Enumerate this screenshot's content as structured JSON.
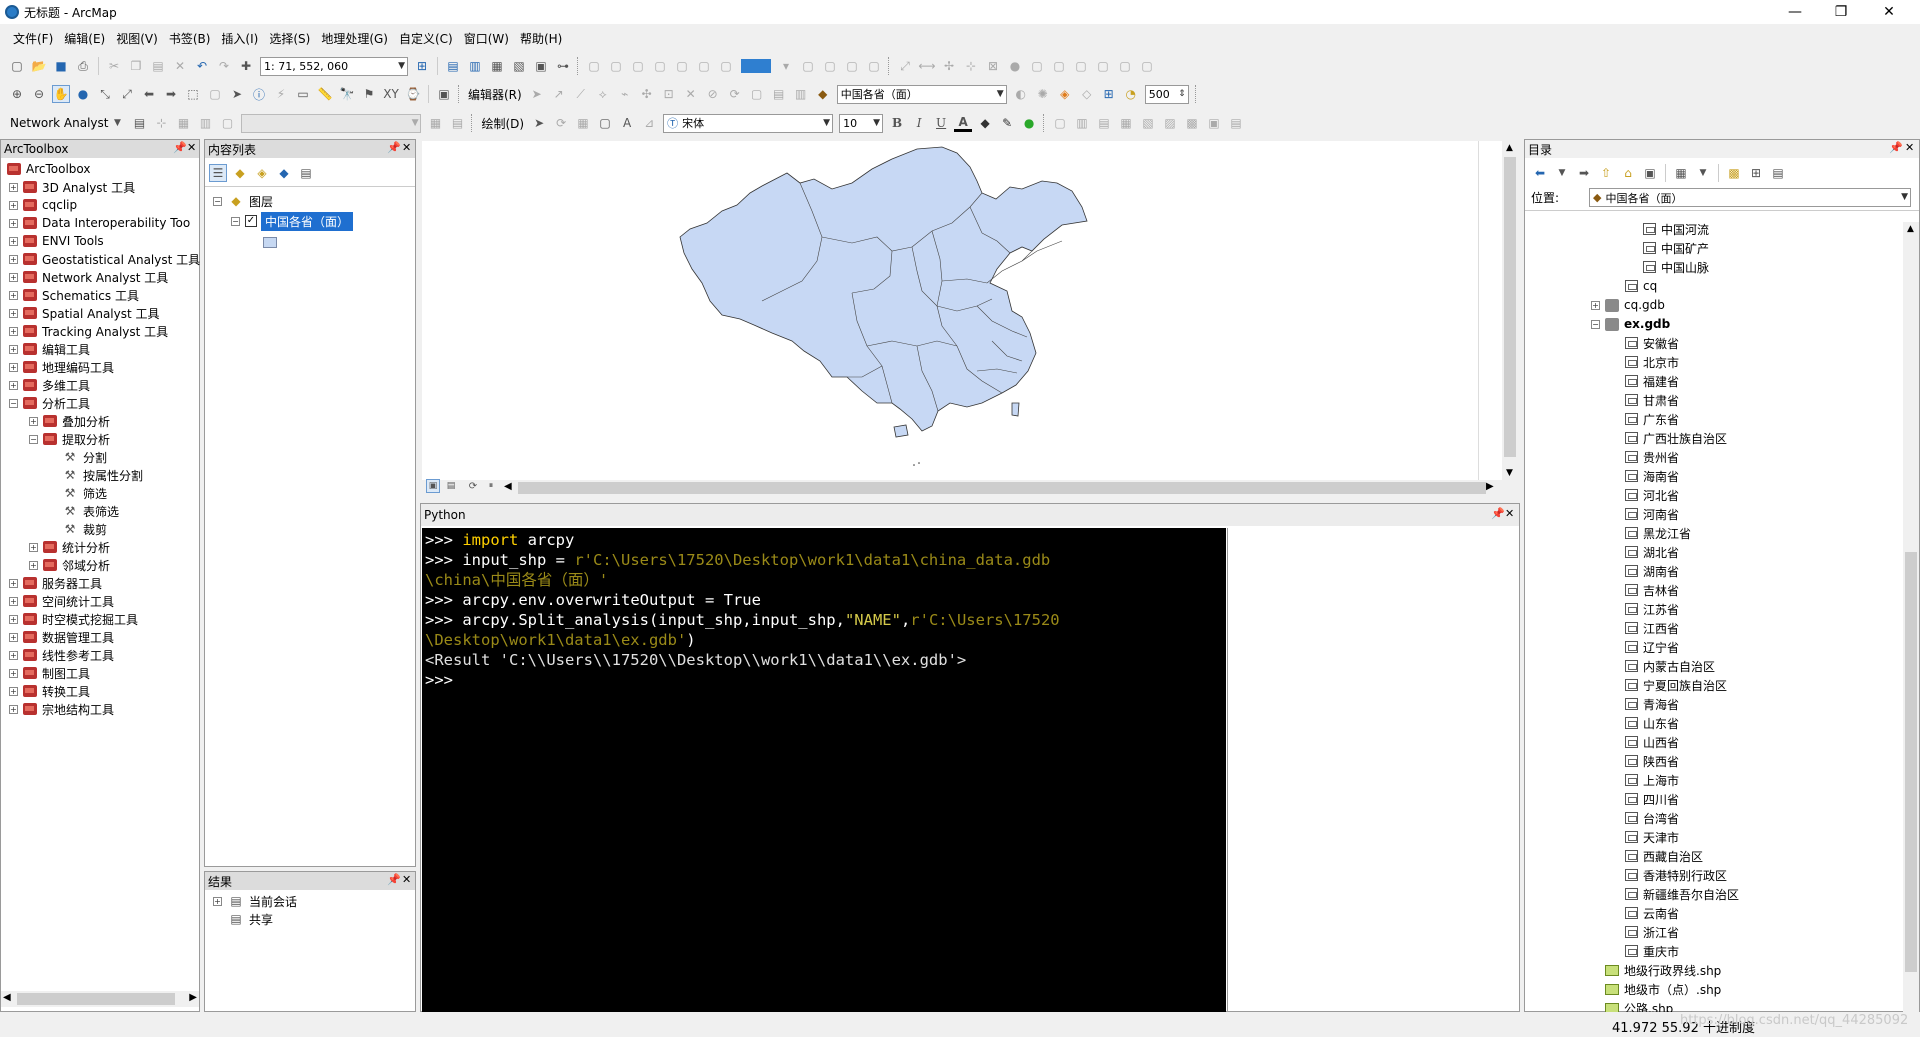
{
  "window": {
    "title": "无标题 - ArcMap",
    "min": "—",
    "max": "❐",
    "close": "✕"
  },
  "menu": [
    "文件(F)",
    "编辑(E)",
    "视图(V)",
    "书签(B)",
    "插入(I)",
    "选择(S)",
    "地理处理(G)",
    "自定义(C)",
    "窗口(W)",
    "帮助(H)"
  ],
  "toolbar1": {
    "scale": "1: 71, 552, 060"
  },
  "toolbar2": {
    "editor_label": "编辑器(R)",
    "layer_combo": "中国各省（面）",
    "value_combo": "500"
  },
  "toolbar3": {
    "network_analyst": "Network Analyst",
    "draw_label": "绘制(D)",
    "font": "宋体",
    "font_size": "10",
    "bold": "B",
    "italic": "I",
    "underline": "U",
    "font_color": "A"
  },
  "arctoolbox": {
    "title": "ArcToolbox",
    "root": "ArcToolbox",
    "items": [
      {
        "label": "3D Analyst 工具",
        "exp": "+"
      },
      {
        "label": "cqclip",
        "exp": "+"
      },
      {
        "label": "Data Interoperability Too",
        "exp": "+"
      },
      {
        "label": "ENVI Tools",
        "exp": "+"
      },
      {
        "label": "Geostatistical Analyst 工具",
        "exp": "+"
      },
      {
        "label": "Network Analyst 工具",
        "exp": "+"
      },
      {
        "label": "Schematics 工具",
        "exp": "+"
      },
      {
        "label": "Spatial Analyst 工具",
        "exp": "+"
      },
      {
        "label": "Tracking Analyst 工具",
        "exp": "+"
      },
      {
        "label": "编辑工具",
        "exp": "+"
      },
      {
        "label": "地理编码工具",
        "exp": "+"
      },
      {
        "label": "多维工具",
        "exp": "+"
      },
      {
        "label": "分析工具",
        "exp": "−"
      }
    ],
    "analysis_children": [
      {
        "label": "叠加分析",
        "exp": "+"
      },
      {
        "label": "提取分析",
        "exp": "−"
      }
    ],
    "extract_tools": [
      "分割",
      "按属性分割",
      "筛选",
      "表筛选",
      "裁剪"
    ],
    "analysis_more": [
      {
        "label": "统计分析",
        "exp": "+"
      },
      {
        "label": "邻域分析",
        "exp": "+"
      }
    ],
    "items_after": [
      {
        "label": "服务器工具",
        "exp": "+"
      },
      {
        "label": "空间统计工具",
        "exp": "+"
      },
      {
        "label": "时空模式挖掘工具",
        "exp": "+"
      },
      {
        "label": "数据管理工具",
        "exp": "+"
      },
      {
        "label": "线性参考工具",
        "exp": "+"
      },
      {
        "label": "制图工具",
        "exp": "+"
      },
      {
        "label": "转换工具",
        "exp": "+"
      },
      {
        "label": "宗地结构工具",
        "exp": "+"
      }
    ]
  },
  "toc": {
    "title": "内容列表",
    "layers_label": "图层",
    "layer_name": "中国各省（面）"
  },
  "results": {
    "title": "结果",
    "items": [
      "当前会话",
      "共享"
    ]
  },
  "python": {
    "title": "Python",
    "prompt": ">>>",
    "line1_kw": "import",
    "line1_rest": " arcpy",
    "line2_a": "input_shp = ",
    "line2_str": "r'C:\\Users\\17520\\Desktop\\work1\\data1\\china_data.gdb",
    "line2_str2": "\\china\\中国各省（面）'",
    "line3": "arcpy.env.overwriteOutput = True",
    "line4_a": "arcpy.Split_analysis(input_shp,input_shp,",
    "line4_name": "\"NAME\"",
    "line4_comma": ",",
    "line4_str": "r'C:\\Users\\17520",
    "line4_str2": "\\Desktop\\work1\\data1\\ex.gdb'",
    "line4_end": ")",
    "result": "<Result 'C:\\\\Users\\\\17520\\\\Desktop\\\\work1\\\\data1\\\\ex.gdb'>"
  },
  "catalog": {
    "title": "目录",
    "location_label": "位置:",
    "location_value": "中国各省（面）",
    "top_items": [
      "中国河流",
      "中国矿产",
      "中国山脉"
    ],
    "cq": "cq",
    "cqgdb": "cq.gdb",
    "exgdb": "ex.gdb",
    "ex_items": [
      "安徽省",
      "北京市",
      "福建省",
      "甘肃省",
      "广东省",
      "广西壮族自治区",
      "贵州省",
      "海南省",
      "河北省",
      "河南省",
      "黑龙江省",
      "湖北省",
      "湖南省",
      "吉林省",
      "江苏省",
      "江西省",
      "辽宁省",
      "内蒙古自治区",
      "宁夏回族自治区",
      "青海省",
      "山东省",
      "山西省",
      "陕西省",
      "上海市",
      "四川省",
      "台湾省",
      "天津市",
      "西藏自治区",
      "香港特别行政区",
      "新疆维吾尔自治区",
      "云南省",
      "浙江省",
      "重庆市"
    ],
    "shp_items": [
      "地级行政界线.shp",
      "地级市（点）.shp",
      "公路.shp"
    ]
  },
  "status": {
    "coords": "41.972  55.92 十进制度",
    "watermark": "https://blog.csdn.net/qq_44285092"
  }
}
